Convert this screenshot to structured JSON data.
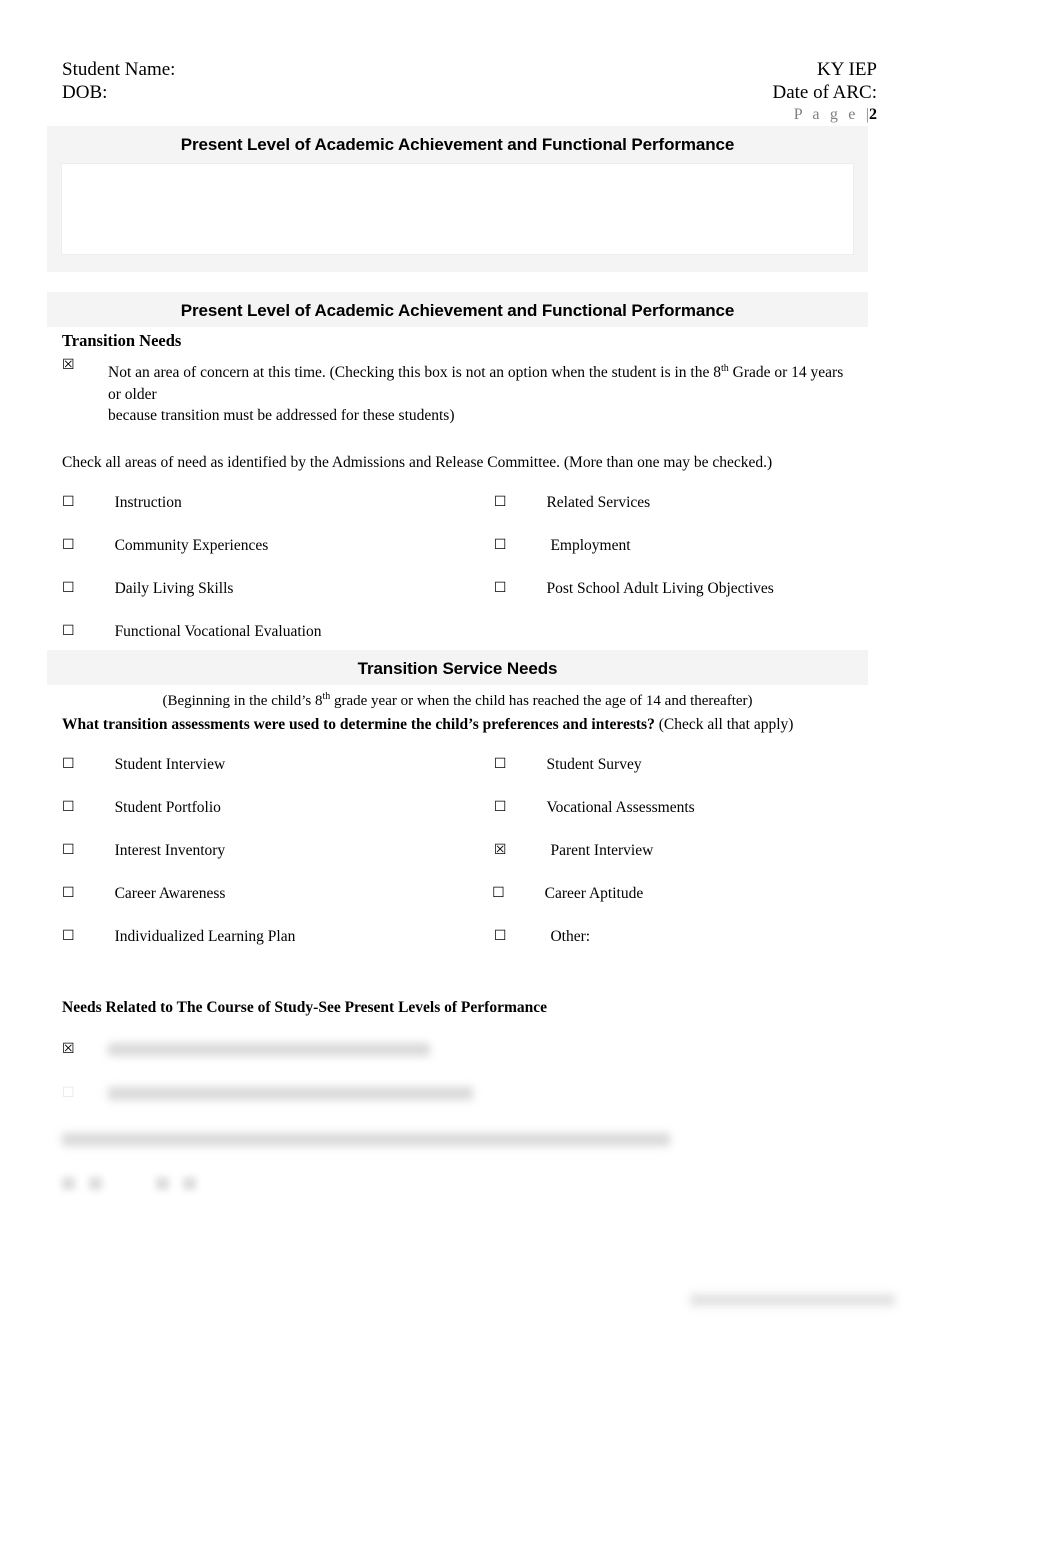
{
  "header": {
    "student_name_label": "Student Name:",
    "dob_label": "DOB:",
    "form_title": "KY IEP",
    "date_of_arc_label": "Date of ARC:",
    "page_word": "P a g e ",
    "page_separator": "|",
    "page_number": "2"
  },
  "panel_present_level_1": {
    "title": "Present Level of Academic Achievement and Functional Performance",
    "content": ""
  },
  "panel_transition_needs": {
    "title": "Present Level of Academic Achievement and Functional Performance",
    "subheading": "Transition Needs",
    "not_concern_checkbox": "☒",
    "not_concern_text_part1": "Not an area of concern at this time. (Checking this box is not an option when the student is in the 8",
    "not_concern_sup": "th",
    "not_concern_text_part2": " Grade or 14 years or older",
    "not_concern_text_line2": "because transition must be addressed for these students)",
    "instruction": "Check all areas of need as identified by the Admissions and Release Committee. (More than one may be checked.)",
    "areas": [
      {
        "label": "Instruction",
        "checked": false,
        "glyph": "☐"
      },
      {
        "label": "Related Services",
        "checked": false,
        "glyph": "☐"
      },
      {
        "label": "Community Experiences",
        "checked": false,
        "glyph": "☐"
      },
      {
        "label": "Employment",
        "checked": false,
        "glyph": "☐"
      },
      {
        "label": "Daily Living Skills",
        "checked": false,
        "glyph": "☐"
      },
      {
        "label": "Post School Adult Living Objectives",
        "checked": false,
        "glyph": "☐"
      },
      {
        "label": "Functional Vocational Evaluation",
        "checked": false,
        "glyph": "☐"
      }
    ]
  },
  "panel_transition_service_needs": {
    "title": "Transition Service Needs",
    "subnote_part1": "(Beginning in the child’s 8",
    "subnote_sup": "th",
    "subnote_part2": " grade year or when the child has reached the age of 14 and thereafter)",
    "question_bold": "What transition assessments were used to determine the child’s preferences and interests?",
    "question_normal": " (Check all that apply)",
    "assessments": [
      {
        "label": "Student Interview",
        "checked": false,
        "glyph": "☐"
      },
      {
        "label": "Student Survey",
        "checked": false,
        "glyph": "☐"
      },
      {
        "label": "Student Portfolio",
        "checked": false,
        "glyph": "☐"
      },
      {
        "label": "Vocational Assessments",
        "checked": false,
        "glyph": "☐"
      },
      {
        "label": "Interest Inventory",
        "checked": false,
        "glyph": "☐"
      },
      {
        "label": "Parent Interview",
        "checked": true,
        "glyph": "☒"
      },
      {
        "label": "Career Awareness",
        "checked": false,
        "glyph": "☐"
      },
      {
        "label": "Career Aptitude",
        "checked": false,
        "glyph": "☐"
      },
      {
        "label": "Individualized Learning Plan",
        "checked": false,
        "glyph": "☐"
      },
      {
        "label": "Other:",
        "checked": false,
        "glyph": "☐"
      }
    ],
    "needs_heading": "Needs Related to The Course of Study-See Present Levels of Performance",
    "redacted_checkbox_1": "☒",
    "redacted_checkbox_2": "☐"
  }
}
